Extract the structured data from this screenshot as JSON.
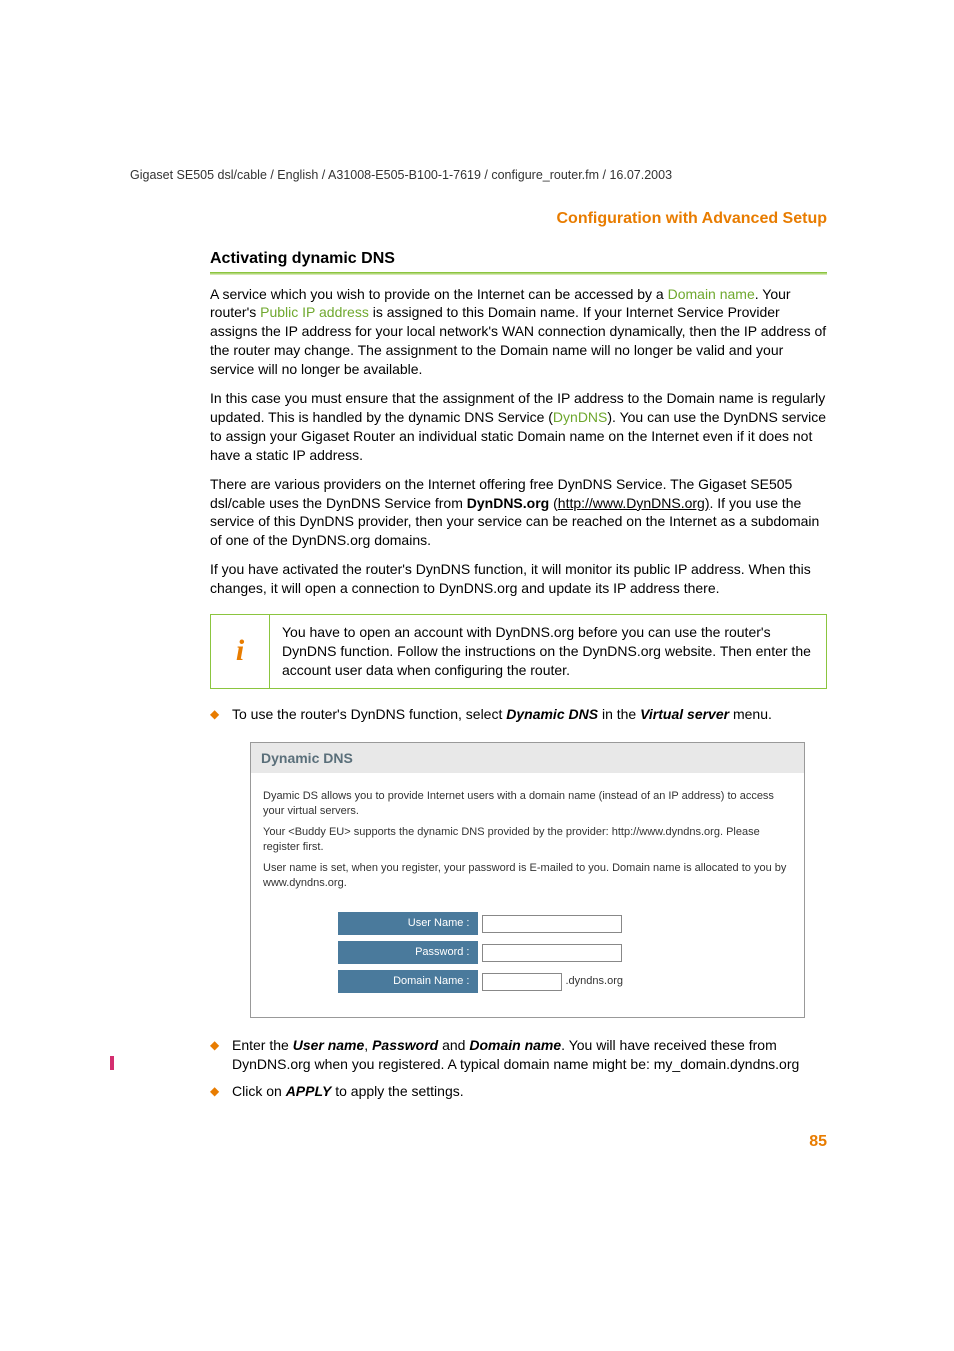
{
  "header_path": "Gigaset SE505 dsl/cable / English / A31008-E505-B100-1-7619 / configure_router.fm / 16.07.2003",
  "section_header": "Configuration with Advanced Setup",
  "subheading": "Activating dynamic DNS",
  "para1_a": "A service which you wish to provide on the Internet can be accessed by a ",
  "para1_link1": "Domain name",
  "para1_b": ". Your router's ",
  "para1_link2": "Public IP address",
  "para1_c": " is assigned to this Domain name. If your Internet Service Provider assigns the IP address for your local network's WAN connection dynamically, then the IP address of the router may change. The assignment to the Domain name will no longer be valid and your service will no longer be available.",
  "para2_a": "In this case you must ensure that the assignment of the IP address to the Domain name is regularly updated. This is handled by the dynamic DNS Service (",
  "para2_link": "DynDNS",
  "para2_b": "). You can use the DynDNS service to assign your Gigaset Router an individual static Domain name on the Internet even if it does not have a static IP address.",
  "para3_a": "There are various providers on the Internet offering free DynDNS Service. The Gigaset SE505 dsl/cable uses the DynDNS Service from ",
  "para3_bold": "DynDNS.org",
  "para3_b": " (",
  "para3_url": "http://www.DynDNS.org)",
  "para3_c": ". If you use the service of this DynDNS provider, then your service can be reached on the Internet as a subdomain of one of the DynDNS.org domains.",
  "para4": "If you have activated the router's DynDNS function, it will monitor its public IP address. When this changes, it will open a connection to DynDNS.org and update its IP address there.",
  "info_text": "You have to open an account with DynDNS.org before you can use the router's DynDNS function. Follow the instructions on the DynDNS.org website. Then enter the account user data when configuring the router.",
  "bullet1_a": "To use the router's DynDNS function, select ",
  "bullet1_b1": "Dynamic DNS",
  "bullet1_c": " in the ",
  "bullet1_b2": "Virtual server",
  "bullet1_d": " menu.",
  "ss_title": "Dynamic DNS",
  "ss_p1": "Dyamic DS allows you to provide Internet users with a domain name (instead of an IP address) to access your virtual servers.",
  "ss_p2": "Your <Buddy EU> supports the dynamic DNS provided by the provider: http://www.dyndns.org. Please register first.",
  "ss_p3": "User name is set, when you register, your password is E-mailed to you. Domain name is allocated to you by www.dyndns.org.",
  "ss_label_user": "User Name :",
  "ss_label_pass": "Password :",
  "ss_label_domain": "Domain Name :",
  "ss_suffix": ".dyndns.org",
  "bullet2_a": "Enter the ",
  "bullet2_b1": "User name",
  "bullet2_b": ", ",
  "bullet2_b2": "Password",
  "bullet2_c": " and ",
  "bullet2_b3": "Domain name",
  "bullet2_d": ". You will have received these from DynDNS.org when you registered. A typical domain name might be: my_domain.dyndns.org",
  "bullet3_a": "Click on ",
  "bullet3_b": "APPLY",
  "bullet3_c": " to apply the settings.",
  "page_number": "85"
}
